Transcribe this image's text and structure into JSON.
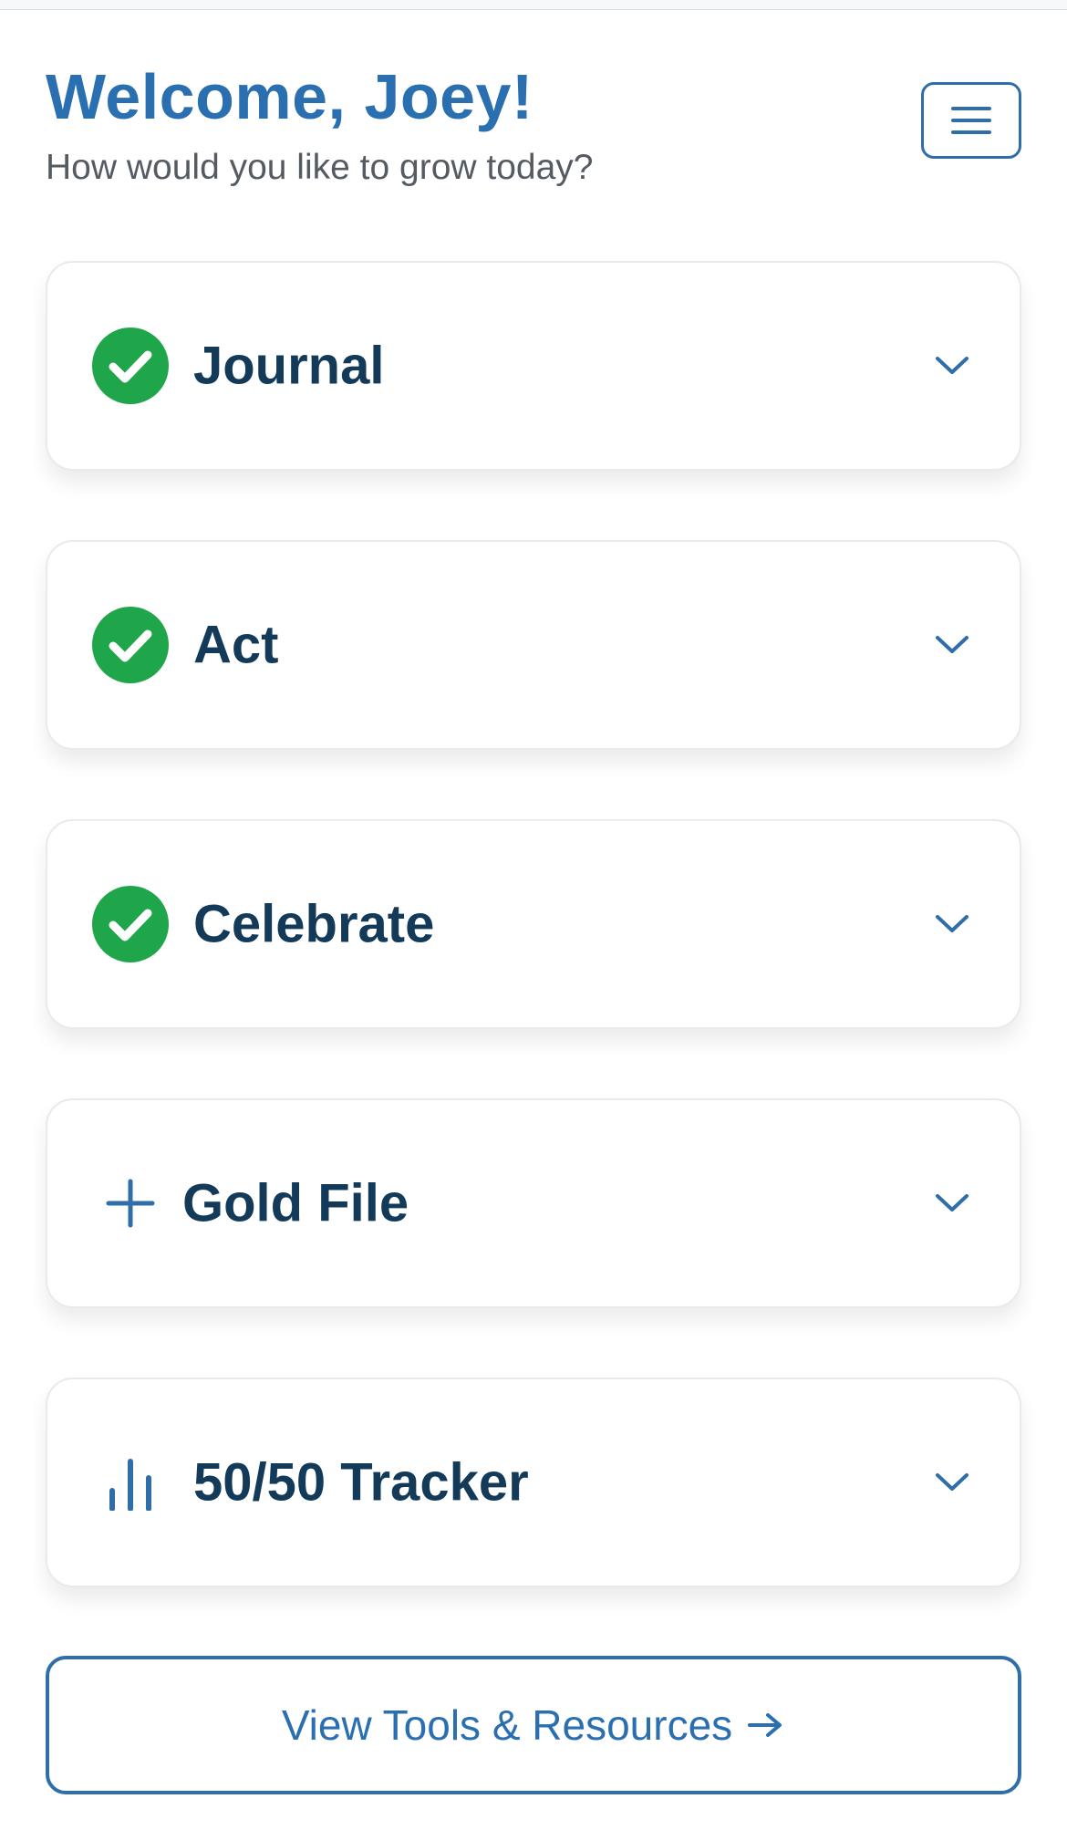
{
  "header": {
    "title": "Welcome, Joey!",
    "subtitle": "How would you like to grow today?"
  },
  "menu": {
    "icon": "hamburger-menu-icon"
  },
  "cards": [
    {
      "label": "Journal",
      "icon": "check-circle-icon",
      "status": "complete"
    },
    {
      "label": "Act",
      "icon": "check-circle-icon",
      "status": "complete"
    },
    {
      "label": "Celebrate",
      "icon": "check-circle-icon",
      "status": "complete"
    },
    {
      "label": "Gold File",
      "icon": "plus-icon",
      "status": "add"
    },
    {
      "label": "50/50 Tracker",
      "icon": "bar-chart-icon",
      "status": "tracker"
    }
  ],
  "tools_button": {
    "label": "View Tools & Resources",
    "icon": "arrow-right-icon"
  },
  "colors": {
    "brand_blue": "#2a6fb0",
    "dark_navy": "#133a59",
    "success_green": "#1fa64a",
    "subtitle_gray": "#555b62"
  }
}
